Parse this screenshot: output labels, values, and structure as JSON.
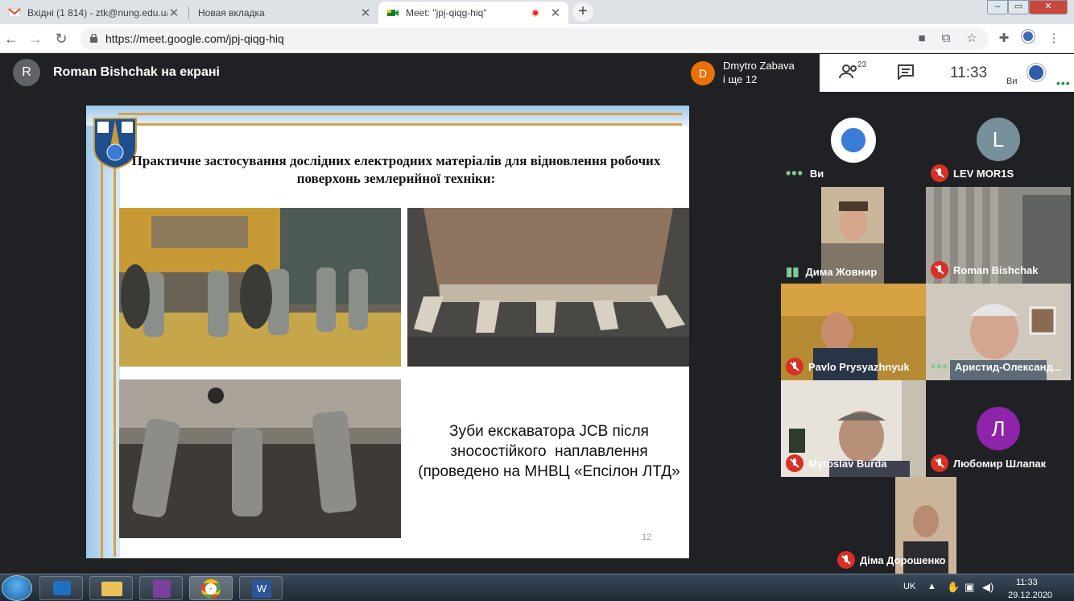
{
  "tabs": [
    {
      "title": "Вхідні (1 814) - ztk@nung.edu.ua",
      "icon": "gmail-icon"
    },
    {
      "title": "Новая вкладка",
      "icon": ""
    },
    {
      "title": "Meet: \"jpj-qiqg-hiq\"",
      "icon": "meet-icon",
      "recording": true
    }
  ],
  "address": {
    "url": "https://meet.google.com/jpj-qiqg-hiq"
  },
  "meet": {
    "presenter_initial": "R",
    "presenter_label": "Roman Bishchak на екрані",
    "notification": {
      "initial": "D",
      "name": "Dmytro Zabava",
      "more": "і ще 12"
    },
    "people_count": "23",
    "time": "11:33",
    "self_label": "Ви"
  },
  "slide": {
    "title": "Практичне застосування дослідних електродних матеріалів для відновлення робочих поверхонь землерийної техніки:",
    "caption_line1": "Зуби екскаватора JCB після",
    "caption_line2": "зносостійкого  наплавлення",
    "caption_line3": "(проведено на МНВЦ «Епсілон ЛТД»",
    "page_number": "12"
  },
  "participants": [
    {
      "name": "Ви",
      "status": "speaking-dots",
      "avatar": "logo"
    },
    {
      "name": "LEV MOR1S",
      "status": "muted",
      "avatar_letter": "L",
      "avatar_color": "#78909c"
    },
    {
      "name": "Дима Жовнир",
      "status": "speaking",
      "avatar": "video"
    },
    {
      "name": "Roman Bishchak",
      "status": "muted",
      "avatar": "video"
    },
    {
      "name": "Pavlo Prysyazhnyuk",
      "status": "muted",
      "avatar": "video"
    },
    {
      "name": "Аристид-Олександ...",
      "status": "speaking-dots",
      "avatar": "video"
    },
    {
      "name": "Myroslav Burda",
      "status": "muted",
      "avatar": "video"
    },
    {
      "name": "Любомир Шлапак",
      "status": "muted",
      "avatar_letter": "Л",
      "avatar_color": "#8e24aa"
    },
    {
      "name": "Діма Дорошенко",
      "status": "muted",
      "avatar": "video"
    }
  ],
  "taskbar": {
    "lang": "UK",
    "time": "11:33",
    "date": "29.12.2020"
  }
}
